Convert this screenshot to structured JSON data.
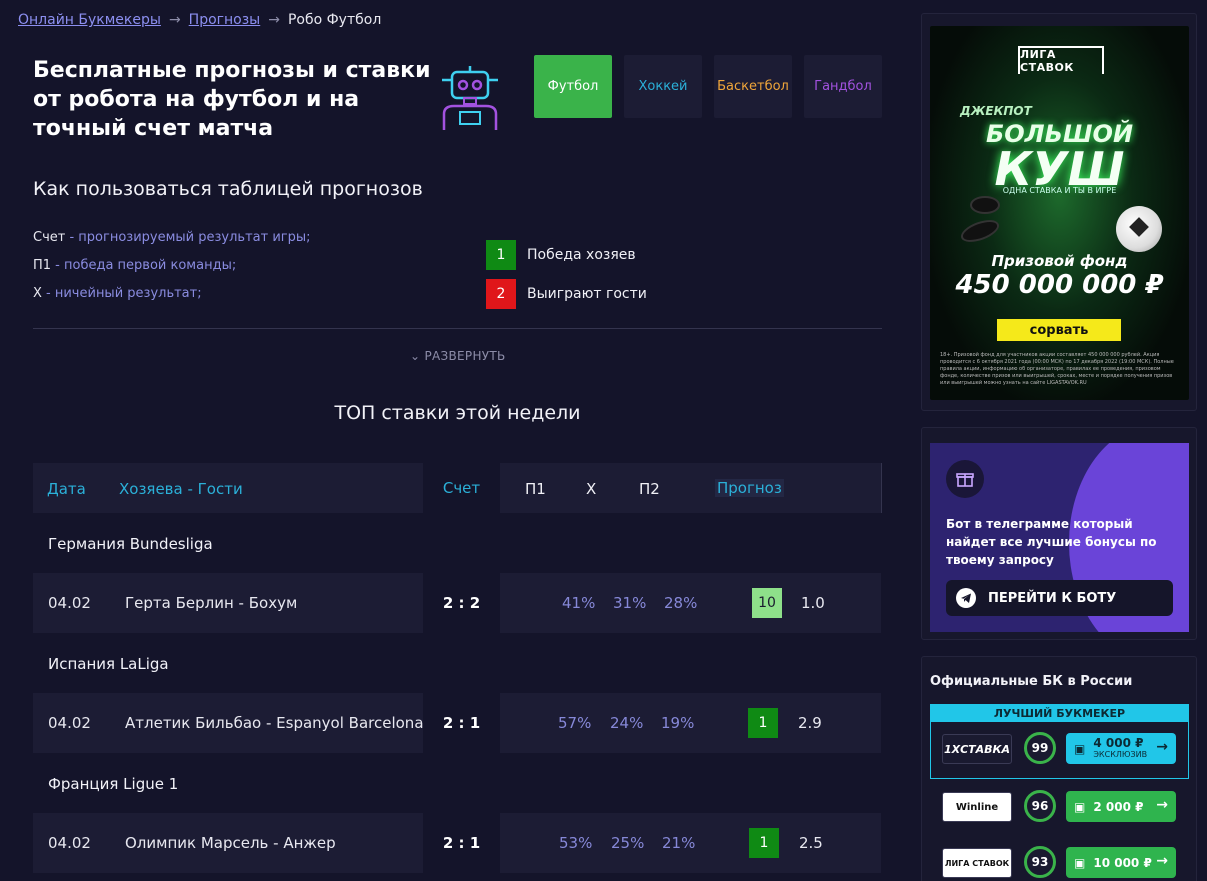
{
  "breadcrumb": {
    "items": [
      "Онлайн Букмекеры",
      "Прогнозы"
    ],
    "separator": "→",
    "current": "Робо Футбол"
  },
  "page_title": "Бесплатные прогнозы и ставки от робота на футбол и на точный счет матча",
  "sports": [
    {
      "label": "Футбол",
      "color": "#ffffff",
      "active": true
    },
    {
      "label": "Хоккей",
      "color": "#2bb0d8",
      "active": false
    },
    {
      "label": "Баскетбол",
      "color": "#f0a63a",
      "active": false
    },
    {
      "label": "Гандбол",
      "color": "#a352e0",
      "active": false
    }
  ],
  "howto": {
    "title": "Как пользоваться таблицей прогнозов",
    "lines": [
      {
        "term": "Счет",
        "hint": " - прогнозируемый результат игры;"
      },
      {
        "term": "П1",
        "hint": " - победа первой команды;"
      },
      {
        "term": "Х",
        "hint": " - ничейный результат;"
      }
    ],
    "boxes": [
      {
        "value": "1",
        "label": "Победа хозяев"
      },
      {
        "value": "2",
        "label": "Выиграют гости"
      }
    ],
    "expand_label": "РАЗВЕРНУТЬ"
  },
  "top": {
    "title": "ТОП ставки этой недели",
    "headers": {
      "date": "Дата",
      "teams": "Хозяева - Гости",
      "score": "Счет",
      "p1": "П1",
      "x": "Х",
      "p2": "П2",
      "forecast": "Прогноз"
    },
    "leagues": [
      {
        "name": "Германия Bundesliga",
        "date": "04.02",
        "teams": "Герта Берлин - Бохум",
        "score": "2 : 2",
        "p1": "41%",
        "x": "31%",
        "p2": "28%",
        "pick": "10",
        "coef": "1.0"
      },
      {
        "name": "Испания LaLiga",
        "date": "04.02",
        "teams": "Атлетик Бильбао - Espanyol Barcelona",
        "score": "2 : 1",
        "p1": "57%",
        "x": "24%",
        "p2": "19%",
        "pick": "1",
        "coef": "2.9"
      },
      {
        "name": "Франция Ligue 1",
        "date": "04.02",
        "teams": "Олимпик Марсель - Анжер",
        "score": "2 : 1",
        "p1": "53%",
        "x": "25%",
        "p2": "21%",
        "pick": "1",
        "coef": "2.5"
      }
    ]
  },
  "ad": {
    "brand": "ЛИГА СТАВОК",
    "jackpot": "ДЖЕКПОТ",
    "headline_1": "БОЛЬШОЙ",
    "headline_2": "КУШ",
    "subline": "ОДНА СТАВКА И ТЫ В ИГРЕ",
    "fund_label": "Призовой фонд",
    "fund_amount": "450 000 000 ₽",
    "cta": "сорвать",
    "fine_print": "18+. Призовой фонд для участников акции составляет 450 000 000 рублей. Акция проводится с 6 октября 2021 года (00:00 МСК) по 17 декабря 2022 (19:00 МСК). Полные правила акции, информацию об организаторе, правилах ее проведения, призовом фонде, количестве призов или выигрышей, сроках, месте и порядке получения призов или выигрышей можно узнать на сайте LIGASTAVOK.RU"
  },
  "telegram": {
    "text": "Бот в телеграмме который найдет все лучшие бонусы по твоему запросу",
    "button": "ПЕРЕЙТИ К БОТУ"
  },
  "bookmakers": {
    "title": "Официальные БК в России",
    "best_label": "ЛУЧШИЙ БУКМЕКЕР",
    "items": [
      {
        "name": "1XСТАВКА",
        "rating": "99",
        "bonus": "4 000 ₽",
        "bonus_note": "ЭКСКЛЮЗИВ"
      },
      {
        "name": "Winline",
        "rating": "96",
        "bonus": "2 000 ₽",
        "bonus_note": ""
      },
      {
        "name": "ЛИГА СТАВОК",
        "rating": "93",
        "bonus": "10 000 ₽",
        "bonus_note": ""
      }
    ]
  }
}
